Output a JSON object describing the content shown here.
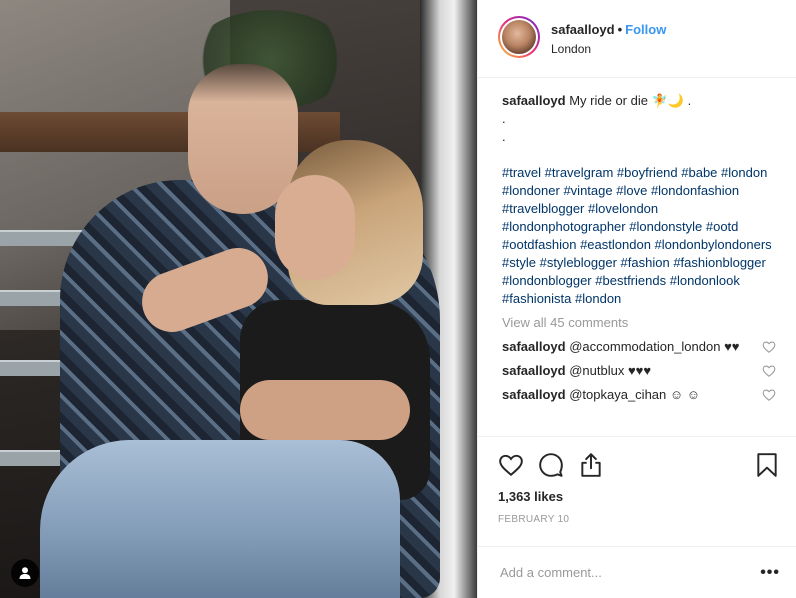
{
  "post": {
    "username": "safaalloyd",
    "follow_label": "Follow",
    "separator": "•",
    "location": "London",
    "caption_text": "My ride or die 🧚🌙 .",
    "caption_dots": [
      ".",
      "."
    ],
    "hashtags": [
      "#travel",
      "#travelgram",
      "#boyfriend",
      "#babe",
      "#london",
      "#londoner",
      "#vintage",
      "#love",
      "#londonfashion",
      "#travelblogger",
      "#lovelondon",
      "#londonphotographer",
      "#londonstyle",
      "#ootd",
      "#ootdfashion",
      "#eastlondon",
      "#londonbylondoners",
      "#style",
      "#styleblogger",
      "#fashion",
      "#fashionblogger",
      "#londonblogger",
      "#bestfriends",
      "#londonlook",
      "#fashionista",
      "#london"
    ],
    "view_all_comments": "View all 45 comments",
    "comments": [
      {
        "user": "safaalloyd",
        "text": "@accommodation_london ♥♥"
      },
      {
        "user": "safaalloyd",
        "text": "@nutblux ♥♥♥"
      },
      {
        "user": "safaalloyd",
        "text": "@topkaya_cihan ☺ ☺"
      }
    ],
    "likes": "1,363 likes",
    "date": "FEBRUARY 10",
    "comment_placeholder": "Add a comment...",
    "more_label": "•••"
  },
  "icons": {
    "like": "heart-icon",
    "comment": "comment-icon",
    "share": "share-icon",
    "save": "bookmark-icon",
    "tag": "user-tag-icon"
  },
  "colors": {
    "follow": "#3897f0",
    "hashtag": "#003569",
    "muted": "#999999",
    "text": "#262626"
  }
}
